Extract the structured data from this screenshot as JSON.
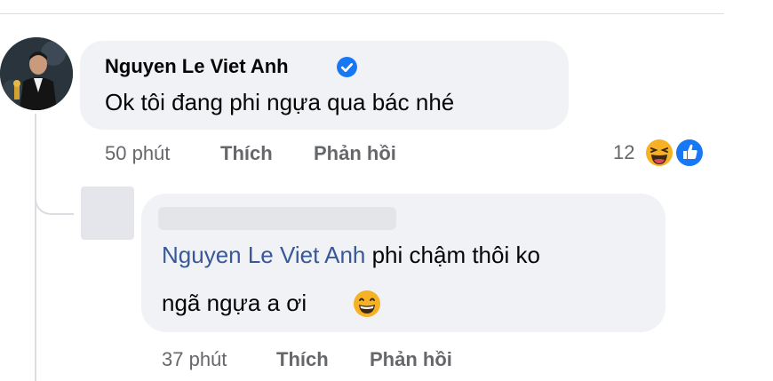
{
  "comment": {
    "author": "Nguyen Le Viet Anh",
    "text": "Ok tôi đang phi ngựa qua bác nhé",
    "time": "50 phút",
    "like_label": "Thích",
    "reply_label": "Phản hồi",
    "reaction_count": "12",
    "reactions": [
      "haha-icon",
      "like-icon"
    ]
  },
  "reply": {
    "mention": "Nguyen Le Viet Anh",
    "text_line1": " phi chậm thôi ko",
    "text_line2": "ngã ngựa a ơi",
    "emoji": "grinning-face-icon",
    "time": "37 phút",
    "like_label": "Thích",
    "reply_label": "Phản hồi"
  },
  "colors": {
    "bubble": "#f0f2f5",
    "meta_text": "#65676b",
    "mention": "#385898",
    "verified": "#1877f2",
    "like_blue": "#1877f2",
    "haha_yellow": "#f7b125"
  }
}
